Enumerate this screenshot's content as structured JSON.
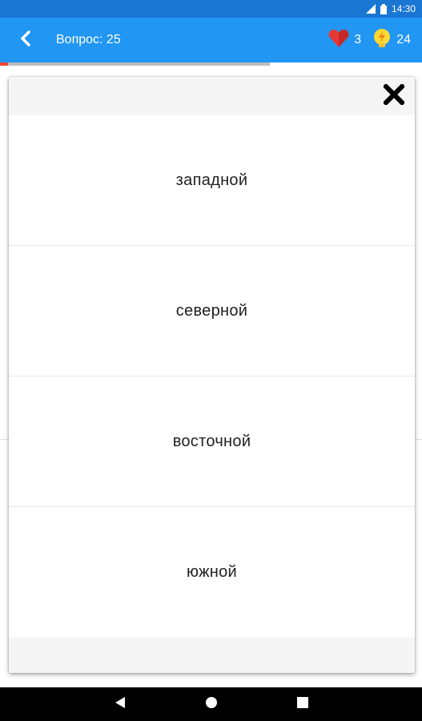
{
  "status_bar": {
    "time": "14:30"
  },
  "app_bar": {
    "title": "Вопрос: 25",
    "lives": "3",
    "hints": "24"
  },
  "progress": {
    "fraction": 0.64
  },
  "dialog": {
    "options": [
      "западной",
      "северной",
      "восточной",
      "южной"
    ]
  },
  "colors": {
    "status_bar": "#1976d2",
    "app_bar": "#2196f3",
    "heart": "#e53935",
    "bulb": "#fdd835"
  },
  "icons": [
    "wifi-icon",
    "battery-icon",
    "back-arrow-icon",
    "heart-icon",
    "bulb-icon",
    "close-icon",
    "nav-back-icon",
    "nav-home-icon",
    "nav-recents-icon"
  ]
}
